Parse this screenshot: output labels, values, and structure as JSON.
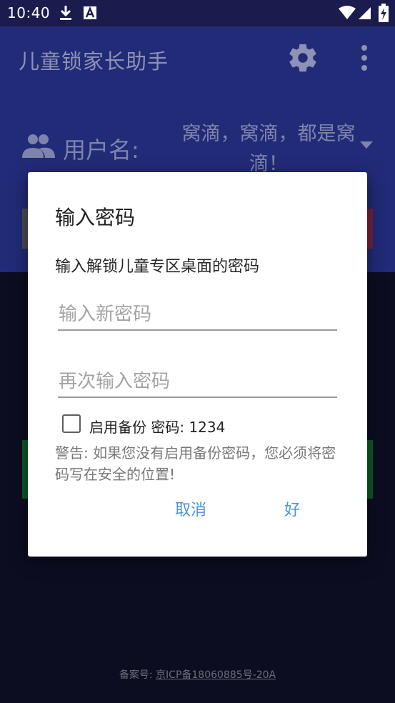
{
  "statusbar": {
    "time": "10:40"
  },
  "app": {
    "title": "儿童锁家长助手",
    "user_label": "用户名:",
    "user_value": "窝滴，窝滴，都是窝滴！"
  },
  "footer": {
    "icp_prefix": "备案号:",
    "icp_number": "京ICP备18060885号-20A"
  },
  "dialog": {
    "title": "输入密码",
    "message": "输入解锁儿童专区桌面的密码",
    "new_password_placeholder": "输入新密码",
    "repeat_password_placeholder": "再次输入密码",
    "backup_label": "启用备份 密码: 1234",
    "warning": "警告: 如果您没有启用备份密码，您必须将密码写在安全的位置!",
    "cancel_label": "取消",
    "ok_label": "好"
  }
}
